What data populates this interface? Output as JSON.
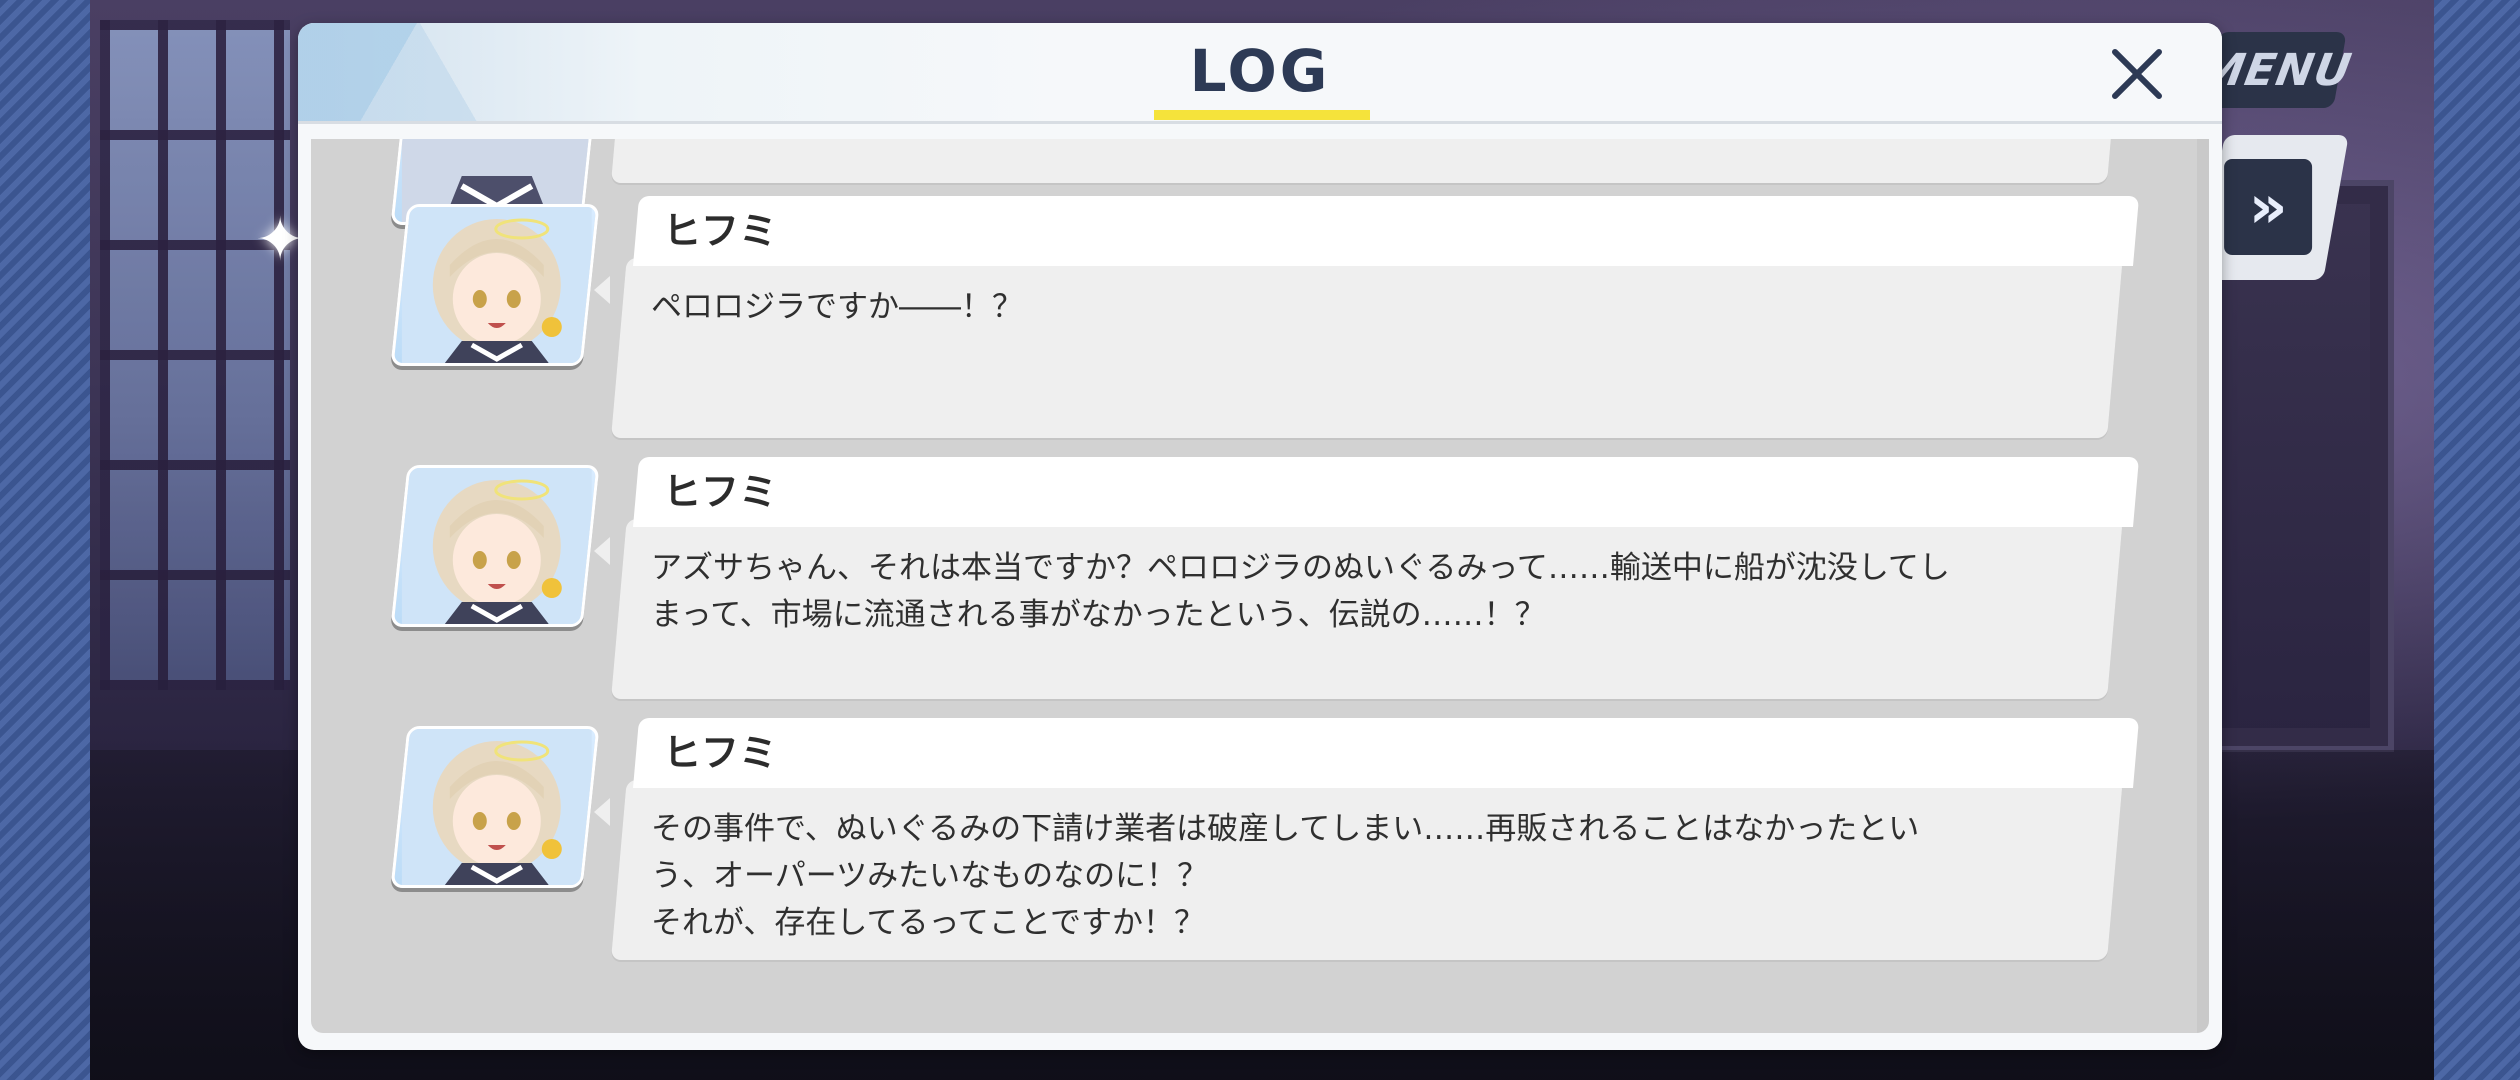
{
  "game_ui": {
    "menu_label": "MENU",
    "fast_forward_icon": "fast-forward-icon"
  },
  "log": {
    "title": "LOG",
    "close_icon": "close-icon",
    "accent_color": "#f5e33b",
    "entries": [
      {
        "speaker": "",
        "message": ""
      },
      {
        "speaker": "ヒフミ",
        "message": "ペロロジラですか――！？"
      },
      {
        "speaker": "ヒフミ",
        "message": "アズサちゃん、それは本当ですか？ペロロジラのぬいぐるみって……輸送中に船が沈没してし\nまって、市場に流通される事がなかったという、伝説の……！？"
      },
      {
        "speaker": "ヒフミ",
        "message": "その事件で、ぬいぐるみの下請け業者は破産してしまい……再販されることはなかったとい\nう、オーパーツみたいなものなのに！？\nそれが、存在してるってことですか！？"
      }
    ]
  }
}
